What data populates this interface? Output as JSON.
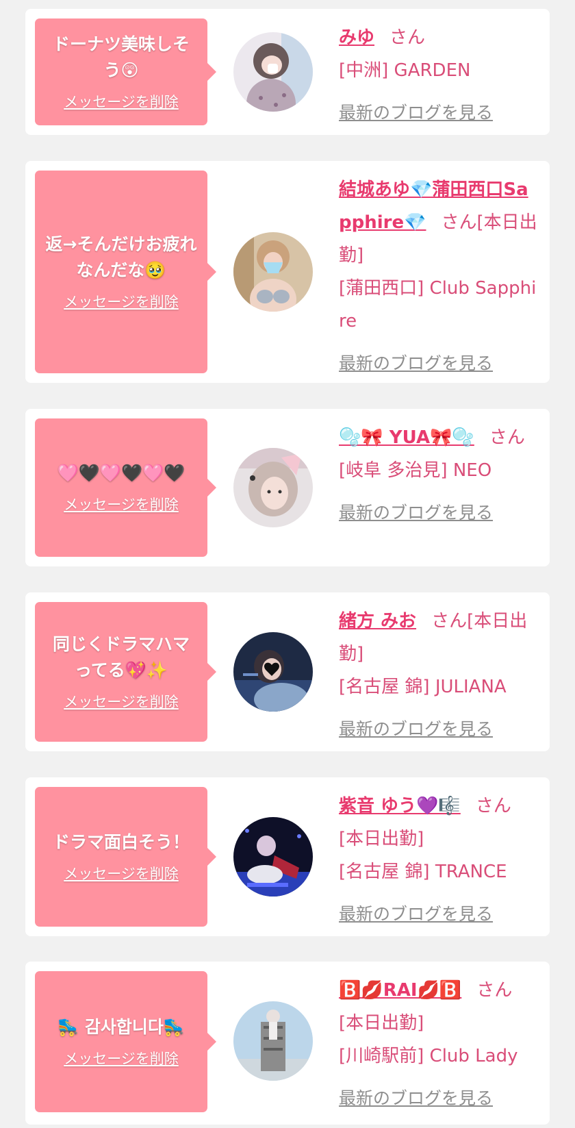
{
  "colors": {
    "page_bg": "#f1f1f1",
    "card_bg": "#ffffff",
    "bubble_bg": "#ff929f",
    "name_color": "#e83a6e",
    "shop_color": "#d94d78",
    "link_gray": "#8e8e8e"
  },
  "cards": [
    {
      "message": "ドーナツ美味しそう😲",
      "delete_label": "メッセージを削除",
      "name": "みゆ",
      "honorific": "さん",
      "status": "",
      "shop": "[中洲] GARDEN",
      "blog_link": "最新のブログを見る",
      "avatar_icon": "avatar-photo"
    },
    {
      "message": "返→そんだけお疲れなんだな🥹",
      "delete_label": "メッセージを削除",
      "name": "結城あゆ💎蒲田西口Sapphire💎",
      "honorific": "さん",
      "status": "[本日出勤]",
      "shop": "[蒲田西口] Club Sapphire",
      "blog_link": "最新のブログを見る",
      "avatar_icon": "avatar-photo"
    },
    {
      "message": "🩷🖤🩷🖤🩷🖤",
      "delete_label": "メッセージを削除",
      "name": "🫧🎀 YUA🎀🫧",
      "honorific": "さん",
      "status": "",
      "shop": "[岐阜 多治見] NEO",
      "blog_link": "最新のブログを見る",
      "avatar_icon": "avatar-photo"
    },
    {
      "message": "同じくドラマハマってる💖✨",
      "delete_label": "メッセージを削除",
      "name": "緒方 みお",
      "honorific": "さん",
      "status": "[本日出勤]",
      "shop": "[名古屋 錦] JULIANA",
      "blog_link": "最新のブログを見る",
      "avatar_icon": "avatar-photo"
    },
    {
      "message": "ドラマ面白そう！",
      "delete_label": "メッセージを削除",
      "name": "紫音 ゆう💜🎼",
      "honorific": "さん",
      "status": "[本日出勤]",
      "shop": "[名古屋 錦] TRANCE",
      "blog_link": "最新のブログを見る",
      "avatar_icon": "avatar-photo"
    },
    {
      "message": "🛼 감사합니다🛼",
      "delete_label": "メッセージを削除",
      "name": "🅱️💋RAI💋🅱️",
      "honorific": "さん",
      "status": "[本日出勤]",
      "shop": "[川崎駅前] Club Lady",
      "blog_link": "最新のブログを見る",
      "avatar_icon": "avatar-photo"
    }
  ]
}
